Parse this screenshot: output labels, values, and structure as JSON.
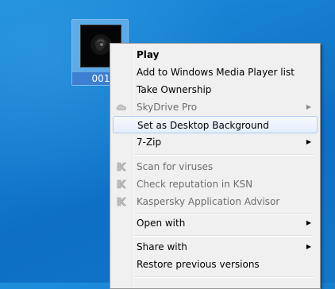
{
  "desktop": {
    "file_icon": {
      "label": "001",
      "thumbnail": "dark-image-thumbnail"
    }
  },
  "context_menu": {
    "items": [
      {
        "label": "Play",
        "bold": true,
        "icon": null,
        "submenu": false,
        "disabled": false
      },
      {
        "label": "Add to Windows Media Player list",
        "icon": null,
        "submenu": false,
        "disabled": false
      },
      {
        "label": "Take Ownership",
        "icon": null,
        "submenu": false,
        "disabled": false
      },
      {
        "label": "SkyDrive Pro",
        "icon": "cloud-icon",
        "submenu": true,
        "disabled": true
      },
      {
        "label": "Set as Desktop Background",
        "icon": null,
        "submenu": false,
        "disabled": false,
        "highlighted": true
      },
      {
        "label": "7-Zip",
        "icon": null,
        "submenu": true,
        "disabled": false
      },
      {
        "label": "Scan for viruses",
        "icon": "kaspersky-icon",
        "submenu": false,
        "disabled": true
      },
      {
        "label": "Check reputation in KSN",
        "icon": "kaspersky-icon",
        "submenu": false,
        "disabled": true
      },
      {
        "label": "Kaspersky Application Advisor",
        "icon": "kaspersky-icon",
        "submenu": false,
        "disabled": true
      },
      {
        "label": "Open with",
        "icon": null,
        "submenu": true,
        "disabled": false
      },
      {
        "label": "Share with",
        "icon": null,
        "submenu": true,
        "disabled": false
      },
      {
        "label": "Restore previous versions",
        "icon": null,
        "submenu": false,
        "disabled": false
      }
    ],
    "submenu_arrow": "▶"
  },
  "colors": {
    "desktop_background": "#147ccd",
    "menu_background": "#f0f0f0",
    "highlight_border": "#aeccf1",
    "disabled_text": "#6d6d6d"
  }
}
